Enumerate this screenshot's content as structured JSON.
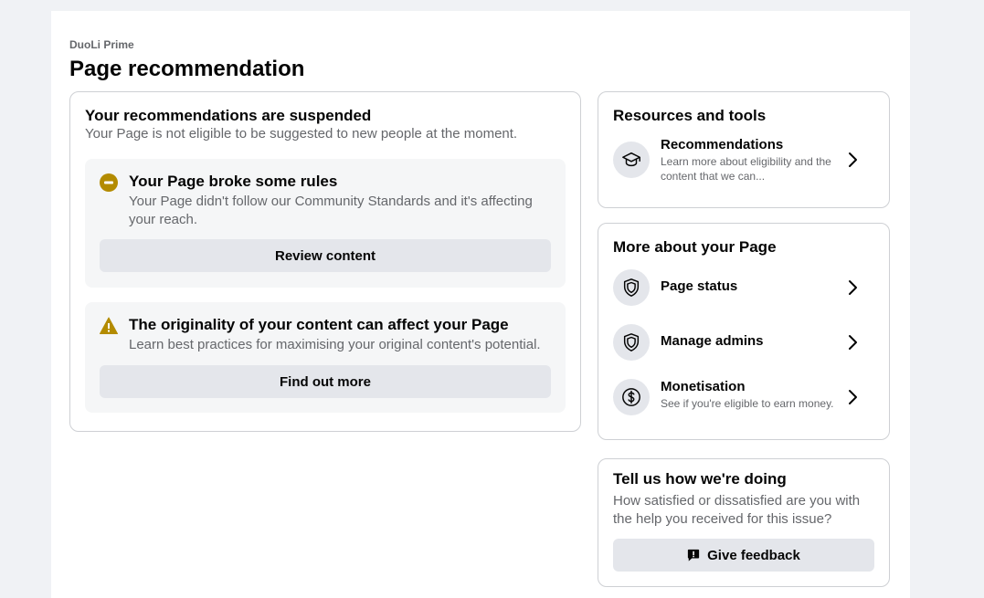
{
  "page": {
    "name": "DuoLi Prime",
    "title": "Page recommendation"
  },
  "main": {
    "heading": "Your recommendations are suspended",
    "subheading": "Your Page is not eligible to be suggested to new people at the moment.",
    "issues": [
      {
        "icon": "minus-circle-icon",
        "title": "Your Page broke some rules",
        "description": "Your Page didn't follow our Community Standards and it's affecting your reach.",
        "button": "Review content"
      },
      {
        "icon": "warning-triangle-icon",
        "title": "The originality of your content can affect your Page",
        "description": "Learn best practices for maximising your original content's potential.",
        "button": "Find out more"
      }
    ]
  },
  "resources": {
    "heading": "Resources and tools",
    "items": [
      {
        "icon": "graduation-cap-icon",
        "title": "Recommendations",
        "description": "Learn more about eligibility and the content that we can..."
      }
    ]
  },
  "more": {
    "heading": "More about your Page",
    "items": [
      {
        "icon": "shield-icon",
        "title": "Page status",
        "description": ""
      },
      {
        "icon": "shield-icon",
        "title": "Manage admins",
        "description": ""
      },
      {
        "icon": "dollar-circle-icon",
        "title": "Monetisation",
        "description": "See if you're eligible to earn money."
      }
    ]
  },
  "feedback": {
    "heading": "Tell us how we're doing",
    "description": "How satisfied or dissatisfied are you with the help you received for this issue?",
    "button": "Give feedback",
    "icon": "feedback-icon"
  },
  "colors": {
    "background": "#f0f2f5",
    "warning": "#b38b00",
    "secondary_text": "#65676b",
    "button_bg": "#e4e6eb"
  }
}
